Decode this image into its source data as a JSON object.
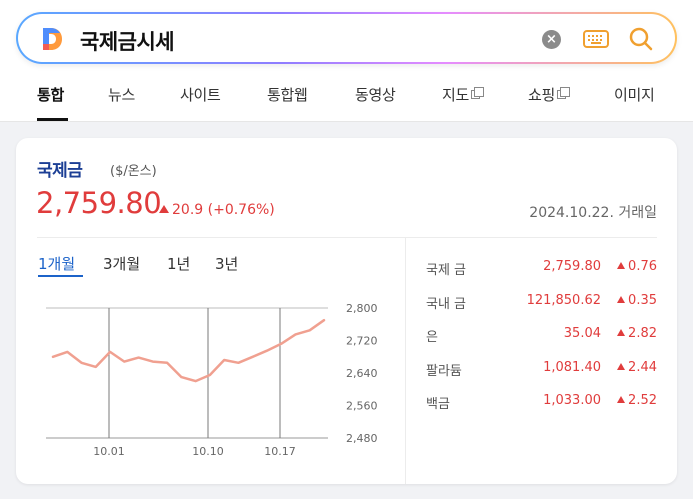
{
  "search": {
    "query": "국제금시세"
  },
  "tabs": [
    {
      "label": "통합"
    },
    {
      "label": "뉴스"
    },
    {
      "label": "사이트"
    },
    {
      "label": "통합웹"
    },
    {
      "label": "동영상"
    },
    {
      "label": "지도"
    },
    {
      "label": "쇼핑"
    },
    {
      "label": "이미지"
    }
  ],
  "card": {
    "title": "국제금",
    "unit": "($/온스)",
    "price": "2,759.80",
    "change": "20.9 (+0.76%)",
    "date": "2024.10.22. 거래일",
    "periods": [
      "1개월",
      "3개월",
      "1년",
      "3년"
    ]
  },
  "metals": [
    {
      "name": "국제 금",
      "value": "2,759.80",
      "change": "0.76"
    },
    {
      "name": "국내 금",
      "value": "121,850.62",
      "change": "0.35"
    },
    {
      "name": "은",
      "value": "35.04",
      "change": "2.82"
    },
    {
      "name": "팔라듐",
      "value": "1,081.40",
      "change": "2.44"
    },
    {
      "name": "백금",
      "value": "1,033.00",
      "change": "2.52"
    }
  ],
  "colors": {
    "price_up": "#e03c3c",
    "line": "#f0a090",
    "title": "#1c3f95",
    "active_period": "#1c63c9"
  },
  "chart_data": {
    "type": "line",
    "x_ticks": [
      "10.01",
      "10.10",
      "10.17"
    ],
    "y_ticks": [
      "2,800",
      "2,720",
      "2,640",
      "2,560",
      "2,480"
    ],
    "ylim": [
      2480,
      2800
    ],
    "series": [
      {
        "values": [
          2680,
          2692,
          2665,
          2655,
          2692,
          2668,
          2678,
          2668,
          2665,
          2630,
          2620,
          2635,
          2672,
          2665,
          2680,
          2695,
          2712,
          2735,
          2745,
          2770
        ]
      }
    ]
  }
}
